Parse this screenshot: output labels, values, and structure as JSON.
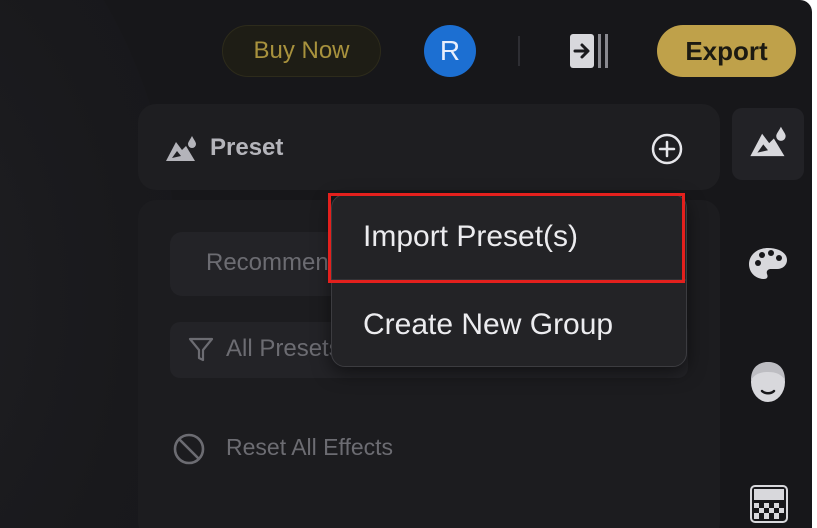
{
  "topbar": {
    "buy_now_label": "Buy Now",
    "avatar_initial": "R",
    "export_label": "Export"
  },
  "preset_panel": {
    "title": "Preset",
    "recommend_tab_label": "Recommended",
    "filter_label": "All Presets",
    "reset_label": "Reset All Effects"
  },
  "dropdown": {
    "items": [
      {
        "label": "Import Preset(s)",
        "highlighted": true
      },
      {
        "label": "Create New Group",
        "highlighted": false
      }
    ]
  },
  "rail": {
    "items": [
      "preset-icon",
      "palette-icon",
      "face-icon",
      "texture-icon"
    ],
    "active": "preset-icon"
  },
  "colors": {
    "background": "#17171a",
    "panel": "#1e1e21",
    "export_accent": "#bfa14a",
    "buy_now_text": "#a8923d",
    "avatar": "#1c6fd2",
    "highlight": "#e3201d"
  }
}
